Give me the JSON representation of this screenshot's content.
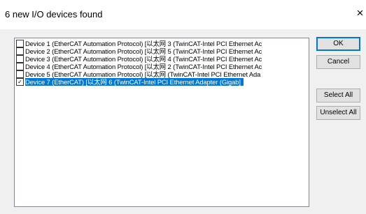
{
  "dialog": {
    "title": "6 new I/O devices found",
    "close_glyph": "×"
  },
  "devices": [
    {
      "checked": false,
      "selected": false,
      "label": "Device 1 (EtherCAT Automation Protocol)     [以太网 3 (TwinCAT-Intel PCI Ethernet Ac"
    },
    {
      "checked": false,
      "selected": false,
      "label": "Device 2 (EtherCAT Automation Protocol)     [以太网 5 (TwinCAT-Intel PCI Ethernet Ac"
    },
    {
      "checked": false,
      "selected": false,
      "label": "Device 3 (EtherCAT Automation Protocol)     [以太网 4 (TwinCAT-Intel PCI Ethernet Ac"
    },
    {
      "checked": false,
      "selected": false,
      "label": "Device 4 (EtherCAT Automation Protocol)     [以太网 2 (TwinCAT-Intel PCI Ethernet Ac"
    },
    {
      "checked": false,
      "selected": false,
      "label": "Device 5 (EtherCAT Automation Protocol)     [以太网 (TwinCAT-Intel PCI Ethernet Ada"
    },
    {
      "checked": true,
      "selected": true,
      "label": "Device 7 (EtherCAT)     [以太网 6 (TwinCAT-Intel PCI Ethernet Adapter (Gigab]"
    }
  ],
  "buttons": {
    "ok": "OK",
    "cancel": "Cancel",
    "select_all": "Select All",
    "unselect_all": "Unselect All"
  },
  "colors": {
    "selection": "#0078d7",
    "dialog_background": "#f0f0f0"
  }
}
